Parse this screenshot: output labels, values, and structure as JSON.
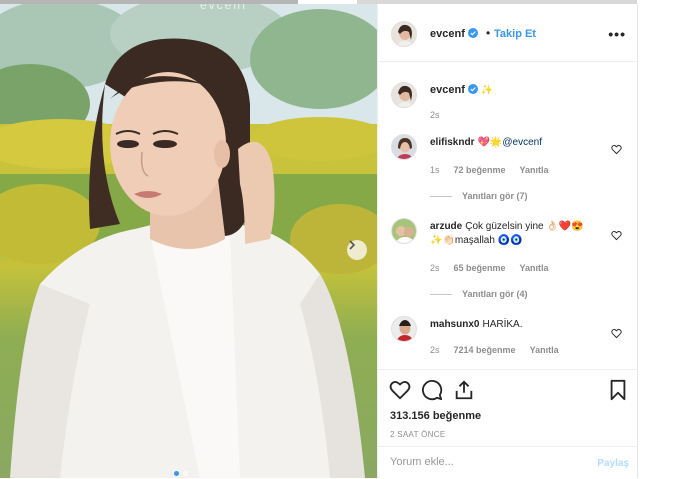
{
  "post": {
    "photo_watermark": "evcenf",
    "photo_alt": "photo"
  },
  "header": {
    "username": "evcenf",
    "bullet": "•",
    "follow_label": "Takip Et",
    "more_label": "•••"
  },
  "caption": {
    "username": "evcenf",
    "emoji": "✨",
    "time": "2s"
  },
  "comments": [
    {
      "username": "elifiskndr",
      "emoji": "💖🌟",
      "mention": "@evcenf",
      "text": "",
      "time": "1s",
      "likes": "72 beğenme",
      "reply": "Yanıtla",
      "view_replies": "Yanıtları gör (7)"
    },
    {
      "username": "arzude",
      "text": "Çok güzelsin yine 👌🏻❤️😍",
      "text2": "✨👏🏻maşallah 🧿🧿",
      "time": "2s",
      "likes": "65 beğenme",
      "reply": "Yanıtla",
      "view_replies": "Yanıtları gör (4)"
    },
    {
      "username": "mahsunx0",
      "text": "HARİKA.",
      "time": "2s",
      "likes": "7214 beğenme",
      "reply": "Yanıtla"
    }
  ],
  "actions": {
    "likes": "313.156 beğenme",
    "post_time": "2 SAAT ÖNCE"
  },
  "comment_box": {
    "placeholder": "Yorum ekle...",
    "submit_label": "Paylaş"
  },
  "colors": {
    "accent": "#3897f0",
    "muted": "#8e8e8e",
    "text": "#262626",
    "submit_disabled": "#b3dbff"
  }
}
